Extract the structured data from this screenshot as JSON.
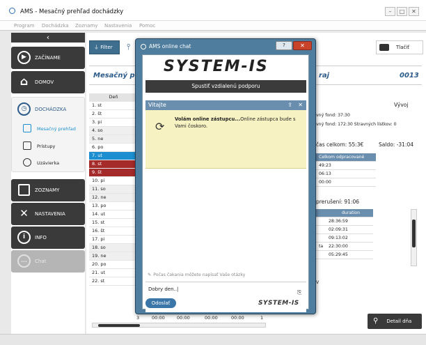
{
  "window": {
    "title": "AMS - Mesačný prehľad dochádzky",
    "controls": [
      "–",
      "□",
      "✕"
    ]
  },
  "menu": [
    "Program",
    "Dochádzka",
    "Zoznamy",
    "Nastavenia",
    "Pomoc"
  ],
  "sidebar": {
    "top_icon": "chevron-left-icon",
    "items": [
      {
        "label": "ZAČÍNAME",
        "icon": "play-icon"
      },
      {
        "label": "DOMOV",
        "icon": "home-icon"
      },
      {
        "label": "DOCHÁDZKA",
        "icon": "clock-icon"
      },
      {
        "label": "ZOZNAMY",
        "icon": "list-icon"
      },
      {
        "label": "NASTAVENIA",
        "icon": "tools-icon"
      },
      {
        "label": "INFO",
        "icon": "info-icon"
      },
      {
        "label": "Chat",
        "icon": "chat-icon"
      }
    ],
    "subitems": [
      {
        "label": "Mesačný prehľad",
        "icon": "book-icon"
      },
      {
        "label": "Prístupy",
        "icon": "door-icon"
      },
      {
        "label": "Uzávierka",
        "icon": "lock-icon"
      }
    ]
  },
  "toolbar": {
    "filter": "Filter",
    "print": "Tlačiť"
  },
  "header": {
    "title_left": "Mesačný pre",
    "title_right": "raj",
    "code": "0013"
  },
  "days": {
    "header": "Deň",
    "rows": [
      "1. st",
      "2. št",
      "3. pi",
      "4. so",
      "5. ne",
      "6. po",
      "7. ut",
      "8. st",
      "9. št",
      "10. pi",
      "11. so",
      "12. ne",
      "13. po",
      "14. ut",
      "15. st",
      "16. št",
      "17. pi",
      "18. so",
      "19. ne",
      "20. po",
      "21. ut",
      "22. st"
    ]
  },
  "right_panel": {
    "vyvoj": "Vývoj",
    "fond_line1": "vný fond:  37:30",
    "fond_line2": "vný fond:   172:30  Stravných lístkov:    0",
    "cas_celkom": "čas celkom:  55:3€",
    "saldo": "Saldo:  -31:04",
    "odpracovane_header": "Celkom odpracované",
    "odpracovane": [
      "49:23",
      "06:13",
      "00:00"
    ],
    "prerusenie": "prerušení:  91:06",
    "duration_header": "duration",
    "duration_left": [
      "",
      "",
      "",
      "ta",
      ""
    ],
    "durations": [
      "28:36:59",
      "02:09:31",
      "09:13:02",
      "22:30:00",
      "05:29:45"
    ],
    "right_label": "V"
  },
  "bottom_row": {
    "cells": [
      "3",
      "00:00",
      "00:00",
      "00:00",
      "00:00",
      "1"
    ]
  },
  "detail_btn": "Detail dňa",
  "chat": {
    "title": "AMS online chat",
    "help": "?",
    "logo": "SYSTEM-IS",
    "remote_btn": "Spustiť vzdialenú podporu",
    "section": "Vitajte",
    "notice_bold": "Volám online zástupcu...",
    "notice_rest": "Online zástupca bude s Vami čoskoro.",
    "wait_msg": "Počas čakania môžete napísať Vaše otázky",
    "input_value": "Dobry den..|",
    "send": "Odoslať",
    "small_logo": "SYSTEM-IS"
  }
}
